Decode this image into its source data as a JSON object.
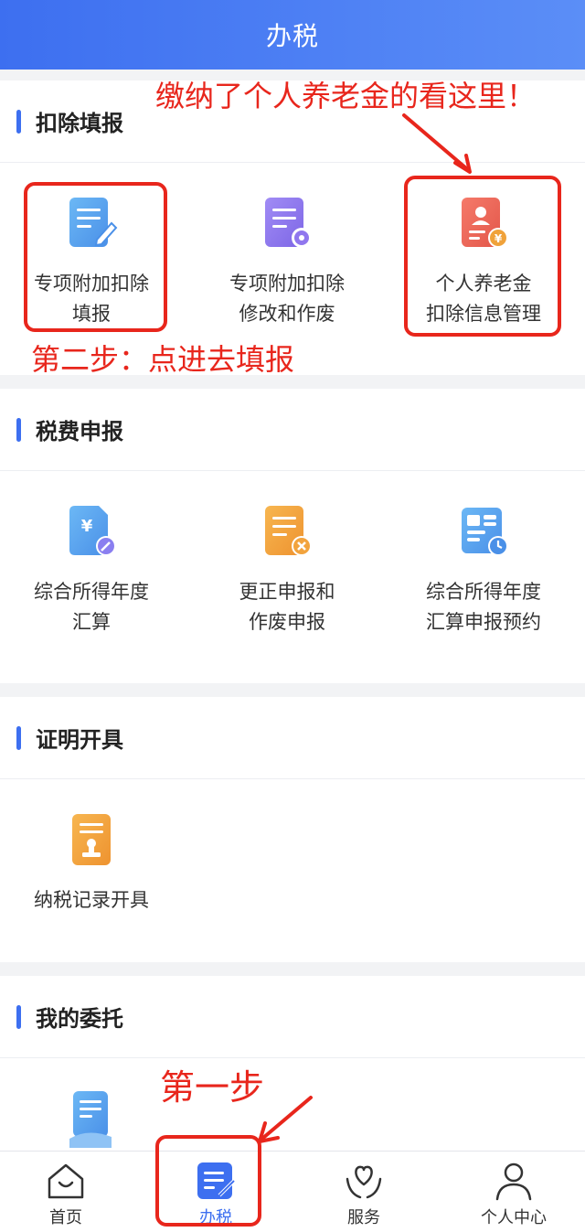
{
  "header": {
    "title": "办税"
  },
  "sections": {
    "deduction": {
      "title": "扣除填报",
      "items": [
        {
          "label": "专项附加扣除\n填报"
        },
        {
          "label": "专项附加扣除\n修改和作废"
        },
        {
          "label": "个人养老金\n扣除信息管理"
        }
      ]
    },
    "declaration": {
      "title": "税费申报",
      "items": [
        {
          "label": "综合所得年度\n汇算"
        },
        {
          "label": "更正申报和\n作废申报"
        },
        {
          "label": "综合所得年度\n汇算申报预约"
        }
      ]
    },
    "certificate": {
      "title": "证明开具",
      "items": [
        {
          "label": "纳税记录开具"
        }
      ]
    },
    "entrust": {
      "title": "我的委托"
    }
  },
  "tabbar": {
    "items": [
      {
        "label": "首页",
        "icon": "home-icon"
      },
      {
        "label": "办税",
        "icon": "tax-icon"
      },
      {
        "label": "服务",
        "icon": "service-icon"
      },
      {
        "label": "个人中心",
        "icon": "profile-icon"
      }
    ]
  },
  "annotations": {
    "top_note": "缴纳了个人养老金的看这里！",
    "step2": "第二步：点进去填报",
    "step1": "第一步"
  },
  "colors": {
    "primary": "#3d6ff0",
    "annotation": "#e8261c"
  }
}
